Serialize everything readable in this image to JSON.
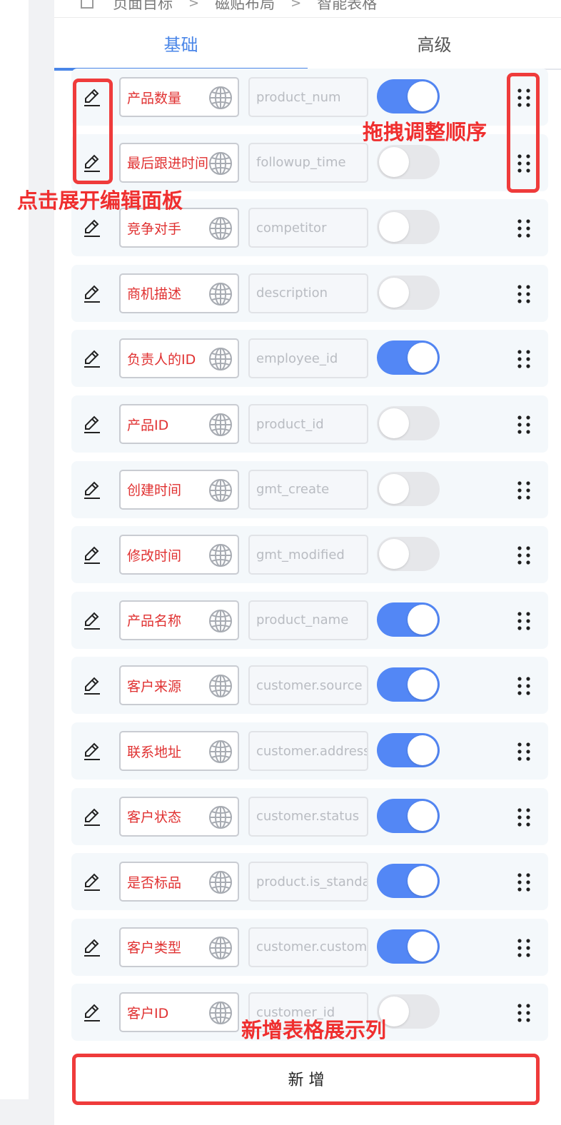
{
  "breadcrumb": [
    "页面目标",
    "磁贴布局",
    "智能表格"
  ],
  "tabs": [
    {
      "label": "基础",
      "active": true
    },
    {
      "label": "高级",
      "active": false
    }
  ],
  "rows": [
    {
      "label": "产品数量",
      "field": "product_num",
      "enabled": true
    },
    {
      "label": "最后跟进时间",
      "field": "followup_time",
      "enabled": false
    },
    {
      "label": "竞争对手",
      "field": "competitor",
      "enabled": false
    },
    {
      "label": "商机描述",
      "field": "description",
      "enabled": false
    },
    {
      "label": "负责人的ID",
      "field": "employee_id",
      "enabled": true
    },
    {
      "label": "产品ID",
      "field": "product_id",
      "enabled": false
    },
    {
      "label": "创建时间",
      "field": "gmt_create",
      "enabled": false
    },
    {
      "label": "修改时间",
      "field": "gmt_modified",
      "enabled": false
    },
    {
      "label": "产品名称",
      "field": "product_name",
      "enabled": true
    },
    {
      "label": "客户来源",
      "field": "customer.source",
      "enabled": true
    },
    {
      "label": "联系地址",
      "field": "customer.address",
      "enabled": true
    },
    {
      "label": "客户状态",
      "field": "customer.status",
      "enabled": true
    },
    {
      "label": "是否标品",
      "field": "product.is_standard",
      "enabled": true
    },
    {
      "label": "客户类型",
      "field": "customer.customer_type",
      "enabled": true
    },
    {
      "label": "客户ID",
      "field": "customer_id",
      "enabled": false
    }
  ],
  "add_button": "新 增",
  "annotations": {
    "expand_panel": "点击展开编辑面板",
    "drag_order": "拖拽调整顺序",
    "add_column": "新增表格展示列"
  },
  "colors": {
    "accent": "#4a86e8",
    "toggle_on": "#5387f5",
    "annotation": "#ef3b3b",
    "label_text": "#e03131"
  },
  "icons": {
    "edit": "pencil-icon",
    "language": "globe-icon",
    "drag": "drag-handle-icon"
  }
}
